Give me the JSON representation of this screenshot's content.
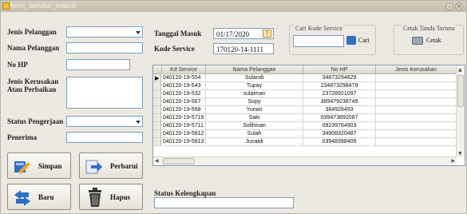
{
  "window": {
    "title": "form_service_masuk"
  },
  "labels": {
    "jenis_pelanggan": "Jenis Pelanggan",
    "nama_pelanggan": "Nama Pelanggan",
    "no_hp": "No HP",
    "jenis_kerusakan": "Jenis Kerusakan",
    "atau_perbaikan": "Atau Perbaikan",
    "status_pengerjaan": "Status Pengerjaan",
    "penerima": "Penerima",
    "tanggal_masuk": "Tanggal Masuk",
    "kode_service": "Kode Service",
    "status_kelengkapan": "Status Kelengkapan"
  },
  "fields": {
    "tanggal_masuk": "01/17/2020",
    "kode_service": "170120-14-1111"
  },
  "search": {
    "group_title": "Cari Kode Service",
    "button": "Cari"
  },
  "print": {
    "group_title": "Cetak Tanda Terima",
    "button": "Cetak"
  },
  "buttons": {
    "simpan": "Simpan",
    "perbarui": "Perbarui",
    "baru": "Baru",
    "hapus": "Hapus"
  },
  "table": {
    "columns": [
      "Kd Service",
      "Nama Pelanggan",
      "No HP",
      "Jenis Kerusakan"
    ],
    "rows": [
      [
        "040120-19-554",
        "Sulandi",
        "34873294829",
        ""
      ],
      [
        "040120-19-543",
        "Tupay",
        "234873298479",
        ""
      ],
      [
        "040120-19-532",
        "sulaiman",
        "23728921097",
        ""
      ],
      [
        "040120-19-567",
        "Sopy",
        "389479238749",
        ""
      ],
      [
        "040120-19-568",
        "Yunari",
        "384928493",
        ""
      ],
      [
        "040120-19-5719",
        "Saki",
        "039473892087",
        ""
      ],
      [
        "040120-19-5711",
        "Solihinan",
        "09239784903",
        ""
      ],
      [
        "040120-19-5812",
        "Sulah",
        "34908320487",
        ""
      ],
      [
        "040120-19-5813",
        "Junaidi",
        "03948398409",
        ""
      ]
    ]
  },
  "colors": {
    "accent_blue": "#2f6fc6",
    "window_bg": "#ece9e2"
  }
}
